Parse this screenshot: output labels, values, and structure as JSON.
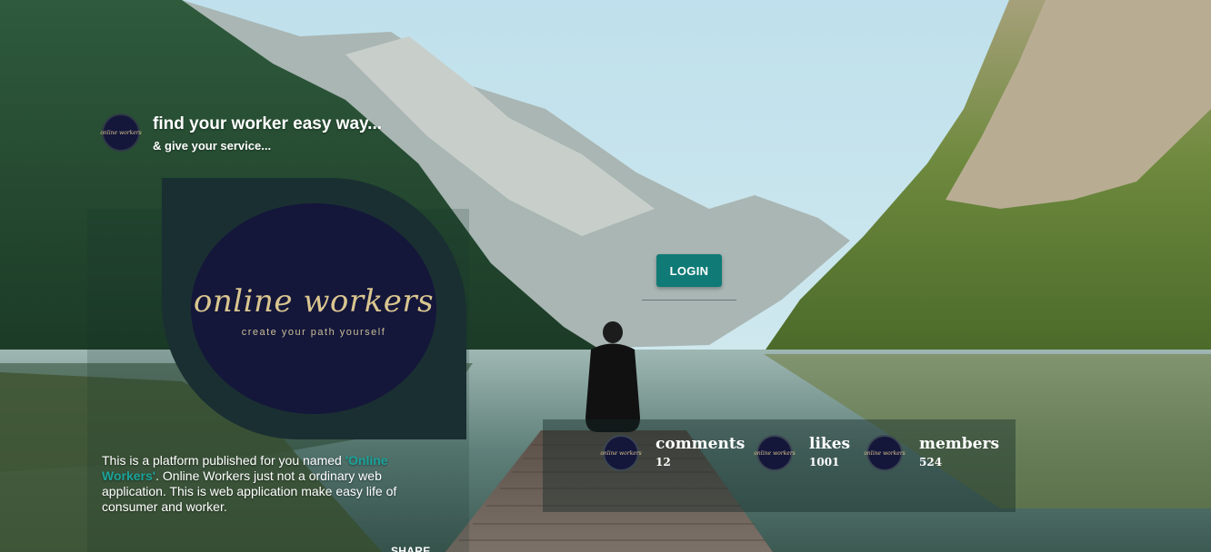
{
  "header": {
    "title": "find your worker easy way...",
    "subtitle": "& give your service..."
  },
  "logo": {
    "wordmark": "online workers",
    "tagline": "create your path yourself",
    "mini_wordmark": "online workers"
  },
  "login_button": {
    "label": "LOGIN"
  },
  "description": {
    "prefix": "This is a platform published for you named ",
    "highlight": "'Online Workers'",
    "suffix": ". Online Workers just not a ordinary web application. This is web application make easy life of consumer and worker."
  },
  "share": {
    "label": "SHARE"
  },
  "stats": [
    {
      "label": "comments",
      "value": "12"
    },
    {
      "label": "likes",
      "value": "1001"
    },
    {
      "label": "members",
      "value": "524"
    }
  ],
  "colors": {
    "accent": "#0f7a76",
    "highlight_text": "#1aa39a",
    "logo_circle": "#14163a",
    "logo_card": "#1a2f32",
    "logo_gold": "#d9c58f"
  },
  "icons": {
    "avatar": "online-workers-logo-icon"
  }
}
